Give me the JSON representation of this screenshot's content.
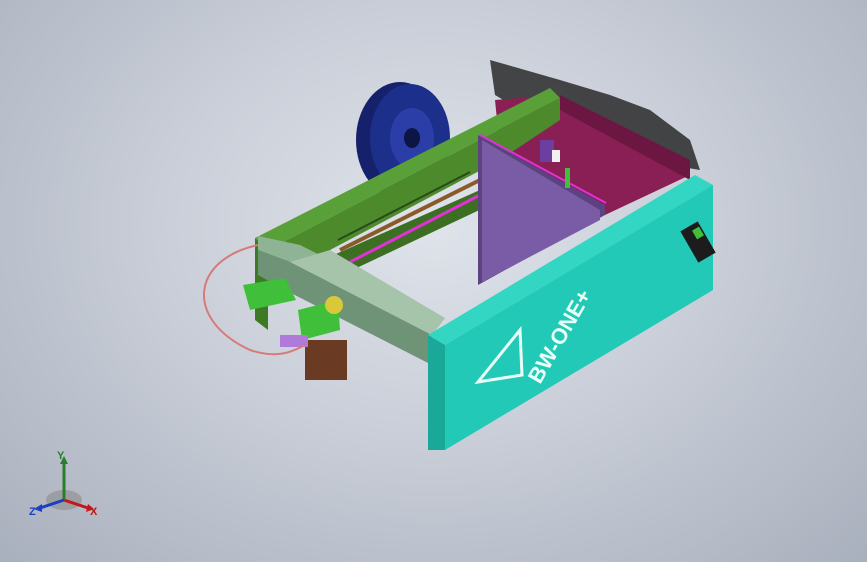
{
  "scene": {
    "brand_text": "BW-ONE+",
    "colors": {
      "background": "#c9ced8",
      "frame_front": "#22c9b6",
      "frame_green": "#4c8a2c",
      "top_rail_gray": "#7fa889",
      "inner_back": "#8a1f55",
      "build_plate": "#7a5ca6",
      "spool": "#1c2f8a",
      "printhead_green": "#3fbf3a",
      "motor": "#6a3a22",
      "wire": "#d87a7a",
      "magenta_line": "#e030d8"
    }
  },
  "triad": {
    "x_label": "X",
    "y_label": "Y",
    "z_label": "Z",
    "x_color": "#c01818",
    "y_color": "#2a7d2a",
    "z_color": "#1a3fc0"
  }
}
